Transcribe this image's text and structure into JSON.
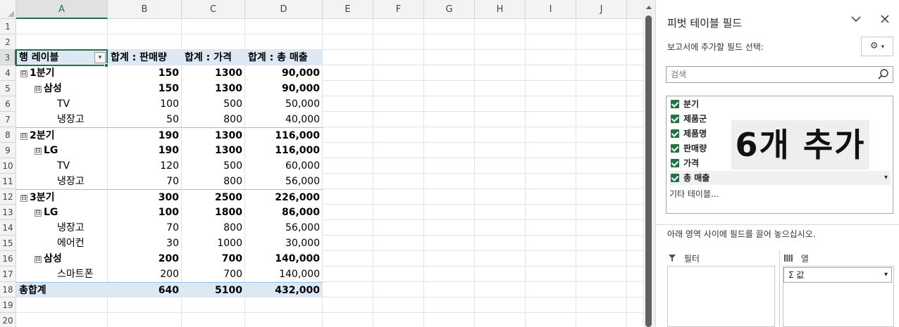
{
  "sheet": {
    "columns": [
      "A",
      "B",
      "C",
      "D",
      "E",
      "F",
      "G",
      "H",
      "I",
      "J"
    ],
    "row_numbers": [
      "1",
      "2",
      "3",
      "4",
      "5",
      "6",
      "7",
      "8",
      "9",
      "10",
      "11",
      "12",
      "13",
      "14",
      "15",
      "16",
      "17",
      "18",
      "19",
      "20"
    ],
    "header": {
      "row_label": "행 레이블",
      "sum_qty": "합계 : 판매량",
      "sum_price": "합계 : 가격",
      "sum_sales": "합계 : 총 매출"
    },
    "toggle_symbol": "⊟",
    "pivot_rows": [
      {
        "label": "1분기",
        "qty": "150",
        "price": "1300",
        "sales": "90,000"
      },
      {
        "label": "삼성",
        "qty": "150",
        "price": "1300",
        "sales": "90,000"
      },
      {
        "label": "TV",
        "qty": "100",
        "price": "500",
        "sales": "50,000"
      },
      {
        "label": "냉장고",
        "qty": "50",
        "price": "800",
        "sales": "40,000"
      },
      {
        "label": "2분기",
        "qty": "190",
        "price": "1300",
        "sales": "116,000"
      },
      {
        "label": "LG",
        "qty": "190",
        "price": "1300",
        "sales": "116,000"
      },
      {
        "label": "TV",
        "qty": "120",
        "price": "500",
        "sales": "60,000"
      },
      {
        "label": "냉장고",
        "qty": "70",
        "price": "800",
        "sales": "56,000"
      },
      {
        "label": "3분기",
        "qty": "300",
        "price": "2500",
        "sales": "226,000"
      },
      {
        "label": "LG",
        "qty": "100",
        "price": "1800",
        "sales": "86,000"
      },
      {
        "label": "냉장고",
        "qty": "70",
        "price": "800",
        "sales": "56,000"
      },
      {
        "label": "에어컨",
        "qty": "30",
        "price": "1000",
        "sales": "30,000"
      },
      {
        "label": "삼성",
        "qty": "200",
        "price": "700",
        "sales": "140,000"
      },
      {
        "label": "스마트폰",
        "qty": "200",
        "price": "700",
        "sales": "140,000"
      }
    ],
    "grand_total": {
      "label": "총합계",
      "qty": "640",
      "price": "5100",
      "sales": "432,000"
    }
  },
  "pane": {
    "title": "피벗 테이블 필드",
    "subtitle": "보고서에 추가할 필드 선택:",
    "search_placeholder": "검색",
    "fields": [
      "분기",
      "제품군",
      "제품명",
      "판매량",
      "가격",
      "총 매출"
    ],
    "more_tables": "기타 테이블...",
    "overlay_text": "6개 추가",
    "drag_hint": "아래 영역 사이에 필드를 끌어 놓으십시오.",
    "filter_area": "필터",
    "columns_area": "열",
    "values_item": "Σ 값"
  },
  "colors": {
    "accent": "#217346",
    "pivot_header_bg": "#dce9f5",
    "pivot_border": "#9bc2e6"
  }
}
